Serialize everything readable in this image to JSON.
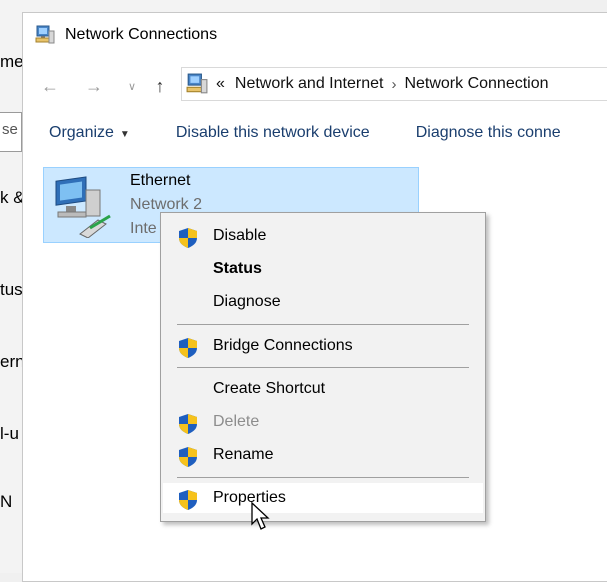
{
  "background_window": {
    "fragments": [
      "me",
      "se",
      "k &",
      "tus",
      "ern",
      "l-u",
      "N"
    ]
  },
  "window": {
    "title": "Network Connections"
  },
  "navigation": {
    "back_icon": "back-arrow-icon",
    "forward_icon": "forward-arrow-icon",
    "recent_icon": "chevron-down-icon",
    "up_icon": "up-arrow-icon",
    "address": {
      "overflow": "«",
      "crumbs": [
        "Network and Internet",
        "Network Connection"
      ]
    }
  },
  "toolbar": {
    "organize": "Organize",
    "disable": "Disable this network device",
    "diagnose": "Diagnose this conne"
  },
  "adapter": {
    "name": "Ethernet",
    "network": "Network 2",
    "device": "Inte"
  },
  "context_menu": {
    "items": [
      {
        "label": "Disable",
        "icon": "uac-shield-icon"
      },
      {
        "label": "Status"
      },
      {
        "label": "Diagnose"
      },
      {
        "label": "Bridge Connections",
        "icon": "uac-shield-icon"
      },
      {
        "label": "Create Shortcut"
      },
      {
        "label": "Delete",
        "icon": "uac-shield-icon",
        "disabled": true
      },
      {
        "label": "Rename",
        "icon": "uac-shield-icon"
      },
      {
        "label": "Properties",
        "icon": "uac-shield-icon",
        "highlighted": true
      }
    ]
  },
  "colors": {
    "selection_bg": "#cce8ff",
    "selection_border": "#99d1ff",
    "link_text": "#1a3e6e",
    "menu_bg": "#f2f2f2"
  }
}
